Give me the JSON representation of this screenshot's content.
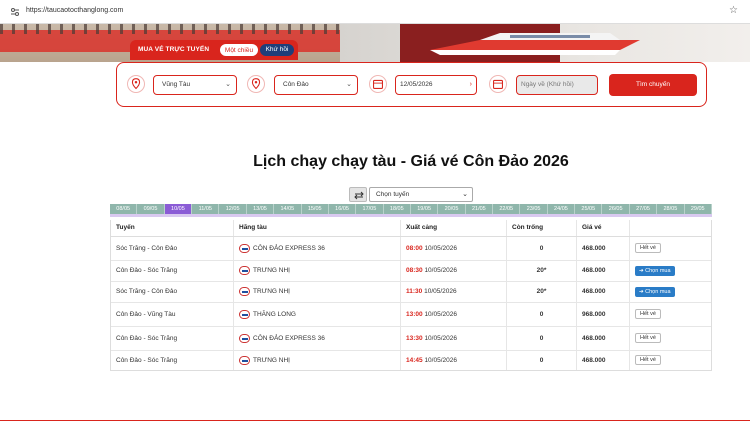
{
  "browser": {
    "url": "https://taucaotocthanglong.com"
  },
  "booking": {
    "tab_title": "MUA VÉ TRỰC TUYẾN",
    "tab_oneway": "Một chiều",
    "tab_return": "Khứ hồi",
    "from": "Vũng Tàu",
    "to": "Côn Đảo",
    "depart_date": "12/05/2026",
    "return_placeholder": "Ngày về (Khứ hồi)",
    "search_label": "Tìm chuyến"
  },
  "page_title": "Lịch chạy chạy tàu - Giá vé Côn Đảo 2026",
  "route_select": {
    "value": "Chọn tuyến"
  },
  "date_strip": [
    "08/05",
    "09/05",
    "10/05",
    "11/05",
    "12/05",
    "13/05",
    "14/05",
    "15/05",
    "16/05",
    "17/05",
    "18/05",
    "19/05",
    "20/05",
    "21/05",
    "22/05",
    "23/05",
    "24/05",
    "25/05",
    "26/05",
    "27/05",
    "28/05",
    "29/05"
  ],
  "date_active_index": 2,
  "table": {
    "headers": [
      "Tuyến",
      "Hãng tàu",
      "Xuất cảng",
      "Còn trống",
      "Giá vé",
      ""
    ],
    "rows": [
      {
        "route": "Sóc Trăng - Côn Đảo",
        "operator": "CÔN ĐẢO EXPRESS 36",
        "time": "08:00",
        "date": "10/05/2026",
        "seats": "0",
        "price": "468.000",
        "action": "Hết vé"
      },
      {
        "route": "Côn Đảo - Sóc Trăng",
        "operator": "TRƯNG NHỊ",
        "time": "08:30",
        "date": "10/05/2026",
        "seats": "20*",
        "price": "468.000",
        "action": "Chọn mua"
      },
      {
        "route": "Sóc Trăng - Côn Đảo",
        "operator": "TRƯNG NHỊ",
        "time": "11:30",
        "date": "10/05/2026",
        "seats": "20*",
        "price": "468.000",
        "action": "Chọn mua"
      },
      {
        "route": "Côn Đảo - Vũng Tàu",
        "operator": "THĂNG LONG",
        "time": "13:00",
        "date": "10/05/2026",
        "seats": "0",
        "price": "968.000",
        "action": "Hết vé"
      },
      {
        "route": "Côn Đảo - Sóc Trăng",
        "operator": "CÔN ĐẢO EXPRESS 36",
        "time": "13:30",
        "date": "10/05/2026",
        "seats": "0",
        "price": "468.000",
        "action": "Hết vé"
      },
      {
        "route": "Côn Đảo - Sóc Trăng",
        "operator": "TRƯNG NHỊ",
        "time": "14:45",
        "date": "10/05/2026",
        "seats": "0",
        "price": "468.000",
        "action": "Hết vé"
      }
    ]
  },
  "colors": {
    "brand_red": "#d9251d",
    "navy": "#1f3e7a",
    "buy_blue": "#2a7cc7",
    "strip_green": "#8fb6ab",
    "strip_active": "#8b5cd6"
  },
  "icons": {
    "site": "site-settings-icon",
    "bookmark": "star-icon",
    "location": "location-pin-icon",
    "calendar": "calendar-icon",
    "swap": "swap-icon"
  }
}
